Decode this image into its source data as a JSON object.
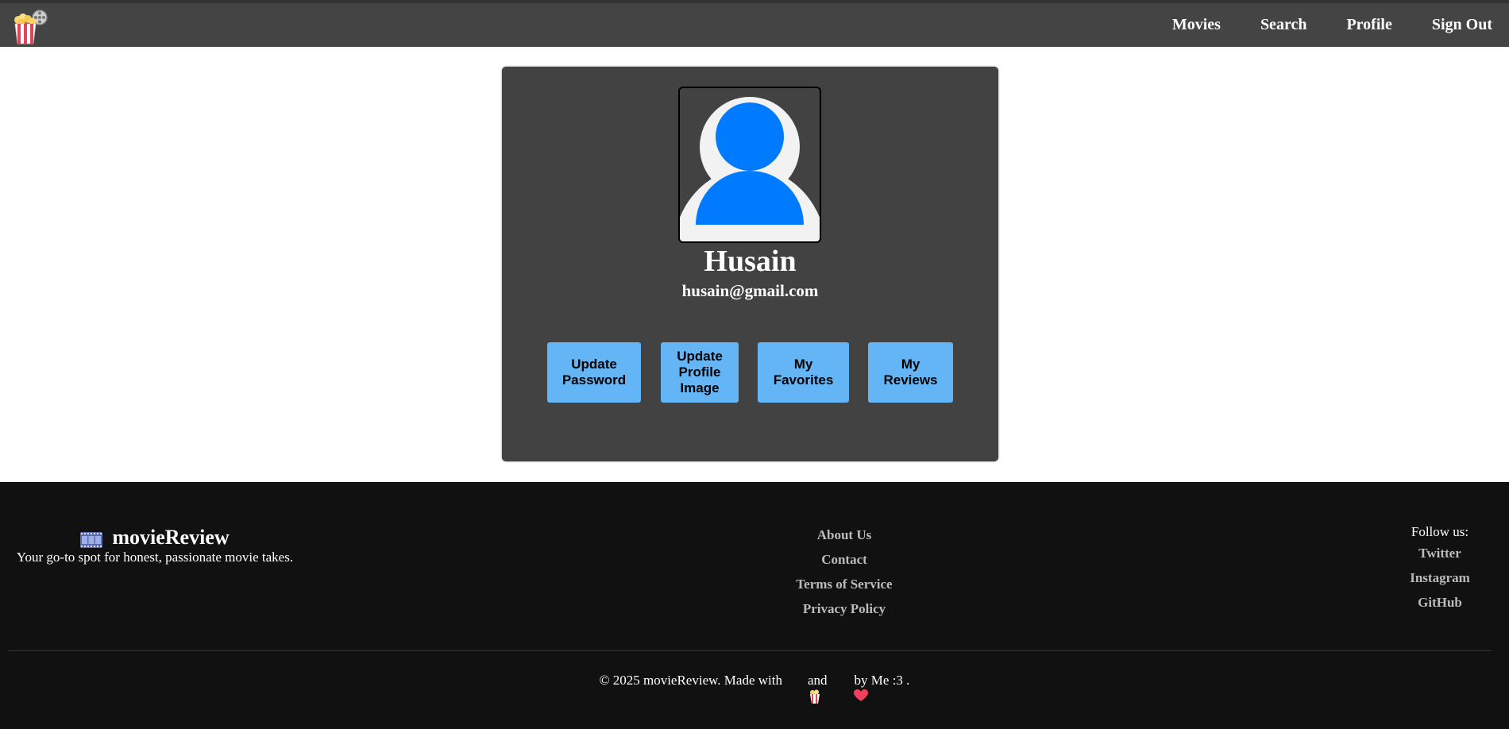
{
  "navbar": {
    "logo_icon": "popcorn-film-reel-icon",
    "links": [
      "Movies",
      "Search",
      "Profile",
      "Sign Out"
    ]
  },
  "profile": {
    "avatar_icon": "user-avatar-icon",
    "name": "Husain",
    "email": "husain@gmail.com",
    "buttons": {
      "update_password": "Update Password",
      "update_profile_image": "Update Profile Image",
      "my_favorites": "My Favorites",
      "my_reviews": "My Reviews"
    }
  },
  "footer": {
    "brand_icon": "film-frames-icon",
    "brand": "movieReview",
    "tagline": "Your go-to spot for honest, passionate movie takes.",
    "links": [
      "About Us",
      "Contact",
      "Terms of Service",
      "Privacy Policy"
    ],
    "follow_label": "Follow us:",
    "social": [
      "Twitter",
      "Instagram",
      "GitHub"
    ],
    "copyright": {
      "prefix": "© 2025 movieReview. Made with",
      "and": "and",
      "suffix": "by Me :3 .",
      "icon1": "popcorn-icon",
      "icon2": "heart-icon"
    }
  },
  "colors": {
    "navbar_bg": "#444444",
    "card_bg": "#424242",
    "button_bg": "#64b5f6",
    "avatar_blue": "#007bff",
    "footer_bg": "#111111"
  }
}
